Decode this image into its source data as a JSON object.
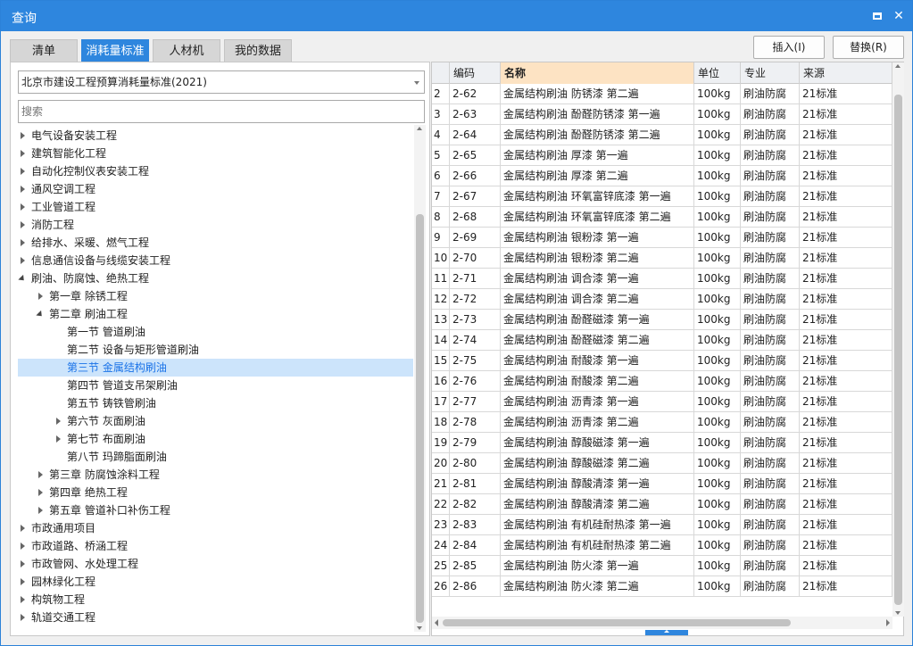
{
  "window": {
    "title": "查询"
  },
  "tabs": [
    {
      "label": "清单",
      "active": false
    },
    {
      "label": "消耗量标准",
      "active": true
    },
    {
      "label": "人材机",
      "active": false
    },
    {
      "label": "我的数据",
      "active": false
    }
  ],
  "actions": {
    "insert_label": "插入(I)",
    "replace_label": "替换(R)"
  },
  "left": {
    "standard_select": "北京市建设工程预算消耗量标准(2021)",
    "search_placeholder": "搜索",
    "tree": [
      {
        "label": "电气设备安装工程",
        "level": 0,
        "state": "collapsed"
      },
      {
        "label": "建筑智能化工程",
        "level": 0,
        "state": "collapsed"
      },
      {
        "label": "自动化控制仪表安装工程",
        "level": 0,
        "state": "collapsed"
      },
      {
        "label": "通风空调工程",
        "level": 0,
        "state": "collapsed"
      },
      {
        "label": "工业管道工程",
        "level": 0,
        "state": "collapsed"
      },
      {
        "label": "消防工程",
        "level": 0,
        "state": "collapsed"
      },
      {
        "label": "给排水、采暖、燃气工程",
        "level": 0,
        "state": "collapsed"
      },
      {
        "label": "信息通信设备与线缆安装工程",
        "level": 0,
        "state": "collapsed"
      },
      {
        "label": "刷油、防腐蚀、绝热工程",
        "level": 0,
        "state": "expanded"
      },
      {
        "label": "第一章 除锈工程",
        "level": 1,
        "state": "collapsed"
      },
      {
        "label": "第二章 刷油工程",
        "level": 1,
        "state": "expanded"
      },
      {
        "label": "第一节 管道刷油",
        "level": 2,
        "state": "leaf"
      },
      {
        "label": "第二节 设备与矩形管道刷油",
        "level": 2,
        "state": "leaf"
      },
      {
        "label": "第三节 金属结构刷油",
        "level": 2,
        "state": "leaf",
        "selected": true
      },
      {
        "label": "第四节 管道支吊架刷油",
        "level": 2,
        "state": "leaf"
      },
      {
        "label": "第五节 铸铁管刷油",
        "level": 2,
        "state": "leaf"
      },
      {
        "label": "第六节 灰面刷油",
        "level": 2,
        "state": "collapsed"
      },
      {
        "label": "第七节 布面刷油",
        "level": 2,
        "state": "collapsed"
      },
      {
        "label": "第八节 玛蹄脂面刷油",
        "level": 2,
        "state": "leaf"
      },
      {
        "label": "第三章 防腐蚀涂料工程",
        "level": 1,
        "state": "collapsed"
      },
      {
        "label": "第四章 绝热工程",
        "level": 1,
        "state": "collapsed"
      },
      {
        "label": "第五章 管道补口补伤工程",
        "level": 1,
        "state": "collapsed"
      },
      {
        "label": "市政通用项目",
        "level": 0,
        "state": "collapsed"
      },
      {
        "label": "市政道路、桥涵工程",
        "level": 0,
        "state": "collapsed"
      },
      {
        "label": "市政管网、水处理工程",
        "level": 0,
        "state": "collapsed"
      },
      {
        "label": "园林绿化工程",
        "level": 0,
        "state": "collapsed"
      },
      {
        "label": "构筑物工程",
        "level": 0,
        "state": "collapsed"
      },
      {
        "label": "轨道交通工程",
        "level": 0,
        "state": "collapsed"
      }
    ]
  },
  "grid": {
    "columns": [
      "",
      "编码",
      "名称",
      "单位",
      "专业",
      "来源"
    ],
    "selected_column": "名称",
    "rows": [
      [
        "2",
        "2-62",
        "金属结构刷油 防锈漆 第二遍",
        "100kg",
        "刷油防腐",
        "21标准"
      ],
      [
        "3",
        "2-63",
        "金属结构刷油 酚醛防锈漆 第一遍",
        "100kg",
        "刷油防腐",
        "21标准"
      ],
      [
        "4",
        "2-64",
        "金属结构刷油 酚醛防锈漆 第二遍",
        "100kg",
        "刷油防腐",
        "21标准"
      ],
      [
        "5",
        "2-65",
        "金属结构刷油 厚漆 第一遍",
        "100kg",
        "刷油防腐",
        "21标准"
      ],
      [
        "6",
        "2-66",
        "金属结构刷油 厚漆 第二遍",
        "100kg",
        "刷油防腐",
        "21标准"
      ],
      [
        "7",
        "2-67",
        "金属结构刷油 环氧富锌底漆 第一遍",
        "100kg",
        "刷油防腐",
        "21标准"
      ],
      [
        "8",
        "2-68",
        "金属结构刷油 环氧富锌底漆 第二遍",
        "100kg",
        "刷油防腐",
        "21标准"
      ],
      [
        "9",
        "2-69",
        "金属结构刷油 银粉漆 第一遍",
        "100kg",
        "刷油防腐",
        "21标准"
      ],
      [
        "10",
        "2-70",
        "金属结构刷油 银粉漆 第二遍",
        "100kg",
        "刷油防腐",
        "21标准"
      ],
      [
        "11",
        "2-71",
        "金属结构刷油 调合漆 第一遍",
        "100kg",
        "刷油防腐",
        "21标准"
      ],
      [
        "12",
        "2-72",
        "金属结构刷油 调合漆 第二遍",
        "100kg",
        "刷油防腐",
        "21标准"
      ],
      [
        "13",
        "2-73",
        "金属结构刷油 酚醛磁漆 第一遍",
        "100kg",
        "刷油防腐",
        "21标准"
      ],
      [
        "14",
        "2-74",
        "金属结构刷油 酚醛磁漆 第二遍",
        "100kg",
        "刷油防腐",
        "21标准"
      ],
      [
        "15",
        "2-75",
        "金属结构刷油 耐酸漆 第一遍",
        "100kg",
        "刷油防腐",
        "21标准"
      ],
      [
        "16",
        "2-76",
        "金属结构刷油 耐酸漆 第二遍",
        "100kg",
        "刷油防腐",
        "21标准"
      ],
      [
        "17",
        "2-77",
        "金属结构刷油 沥青漆 第一遍",
        "100kg",
        "刷油防腐",
        "21标准"
      ],
      [
        "18",
        "2-78",
        "金属结构刷油 沥青漆 第二遍",
        "100kg",
        "刷油防腐",
        "21标准"
      ],
      [
        "19",
        "2-79",
        "金属结构刷油 醇酸磁漆 第一遍",
        "100kg",
        "刷油防腐",
        "21标准"
      ],
      [
        "20",
        "2-80",
        "金属结构刷油 醇酸磁漆 第二遍",
        "100kg",
        "刷油防腐",
        "21标准"
      ],
      [
        "21",
        "2-81",
        "金属结构刷油 醇酸清漆 第一遍",
        "100kg",
        "刷油防腐",
        "21标准"
      ],
      [
        "22",
        "2-82",
        "金属结构刷油 醇酸清漆 第二遍",
        "100kg",
        "刷油防腐",
        "21标准"
      ],
      [
        "23",
        "2-83",
        "金属结构刷油 有机硅耐热漆 第一遍",
        "100kg",
        "刷油防腐",
        "21标准"
      ],
      [
        "24",
        "2-84",
        "金属结构刷油 有机硅耐热漆 第二遍",
        "100kg",
        "刷油防腐",
        "21标准"
      ],
      [
        "25",
        "2-85",
        "金属结构刷油 防火漆 第一遍",
        "100kg",
        "刷油防腐",
        "21标准"
      ],
      [
        "26",
        "2-86",
        "金属结构刷油 防火漆 第二遍",
        "100kg",
        "刷油防腐",
        "21标准"
      ]
    ]
  },
  "colors": {
    "accent": "#2e86de",
    "selected_row_bg": "#cce4fb",
    "selected_header_bg": "#fde3c3"
  },
  "icons": {
    "maximize": "maximize-icon",
    "close": "close-icon"
  }
}
